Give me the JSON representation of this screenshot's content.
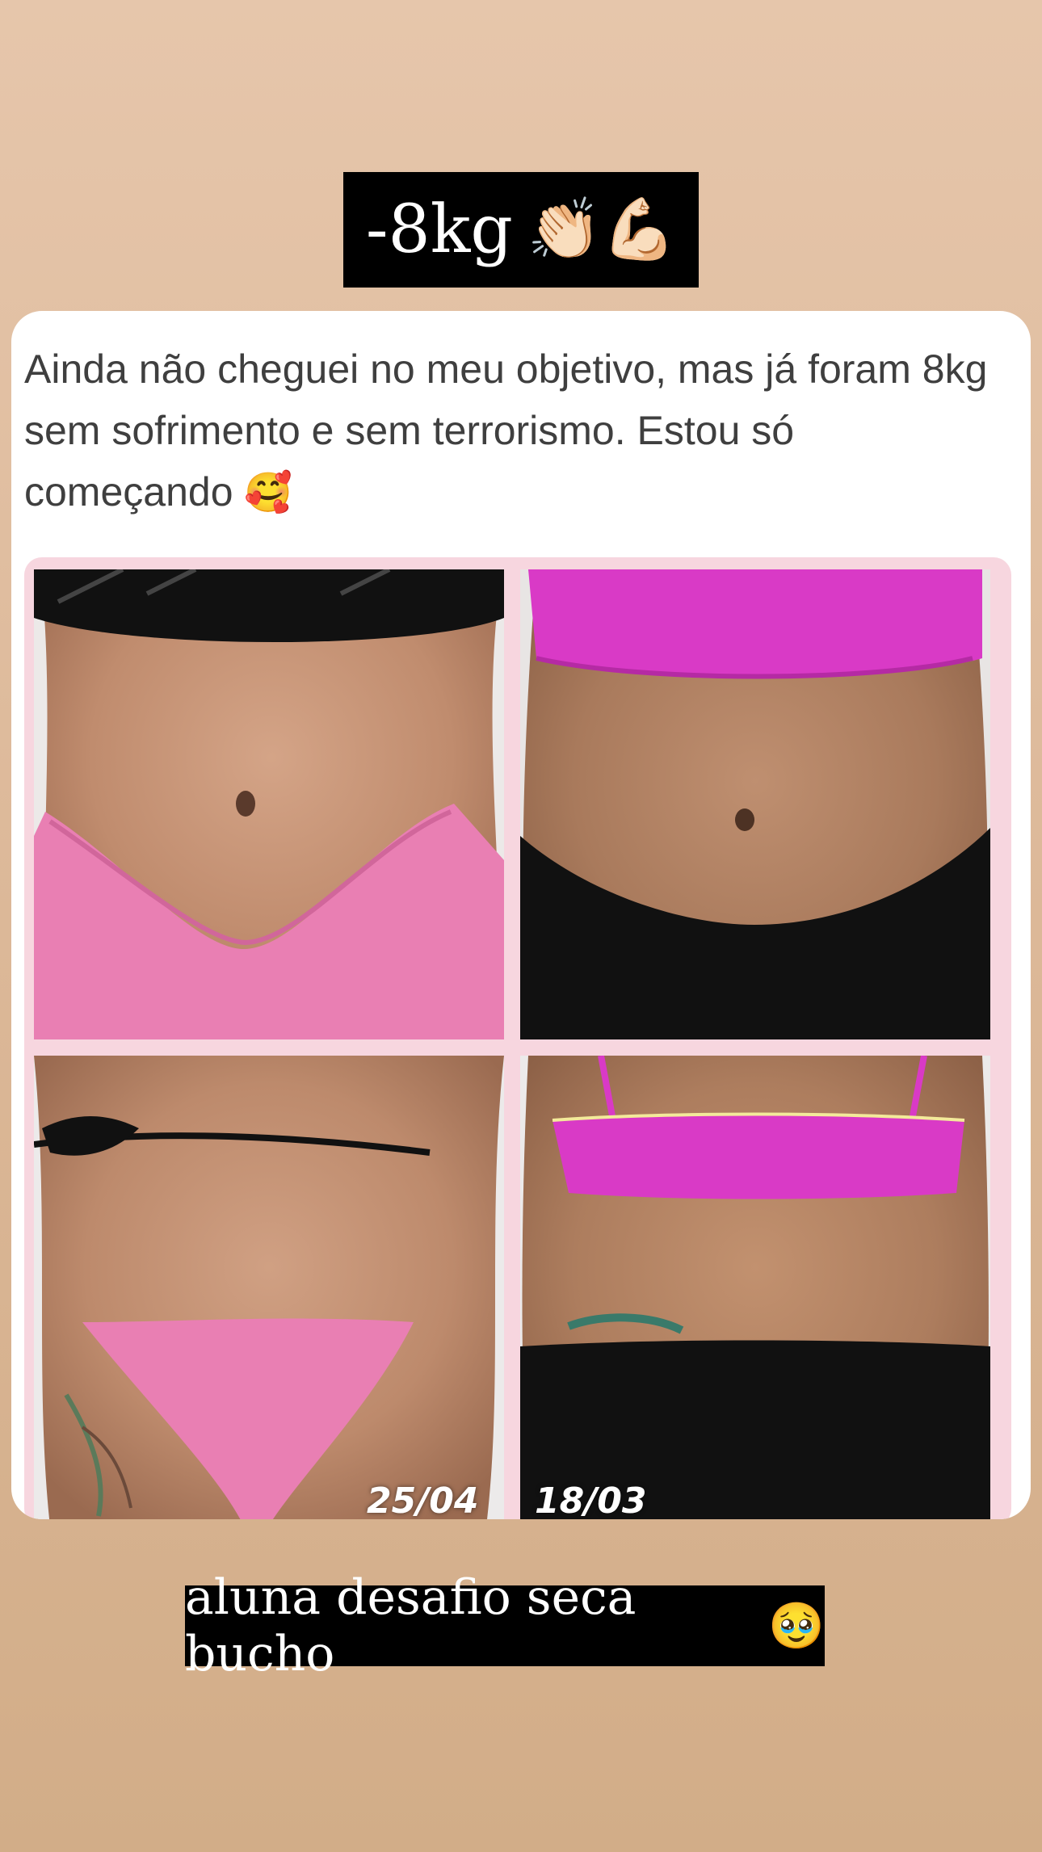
{
  "top_sticker": {
    "text": "-8kg",
    "emoji": "👏🏻💪🏻"
  },
  "post": {
    "text": "Ainda não cheguei no meu objetivo, mas já foram 8kg sem sofrimento e sem terrorismo.  Estou só começando",
    "emoji": "🥰"
  },
  "collage": {
    "photos": [
      {
        "name": "after-front"
      },
      {
        "name": "before-front"
      },
      {
        "name": "after-back",
        "date": "25/04"
      },
      {
        "name": "before-back",
        "date": "18/03"
      }
    ]
  },
  "bottom_sticker": {
    "text": "aluna desafio seca bucho",
    "emoji": "🥹"
  },
  "colors": {
    "background_top": "#e6c6ab",
    "background_bottom": "#d2ad88",
    "sticker_bg": "#000000",
    "collage_frame": "#f7d6df",
    "pink_bikini": "#e97fb3",
    "magenta_top": "#d93ac6"
  }
}
